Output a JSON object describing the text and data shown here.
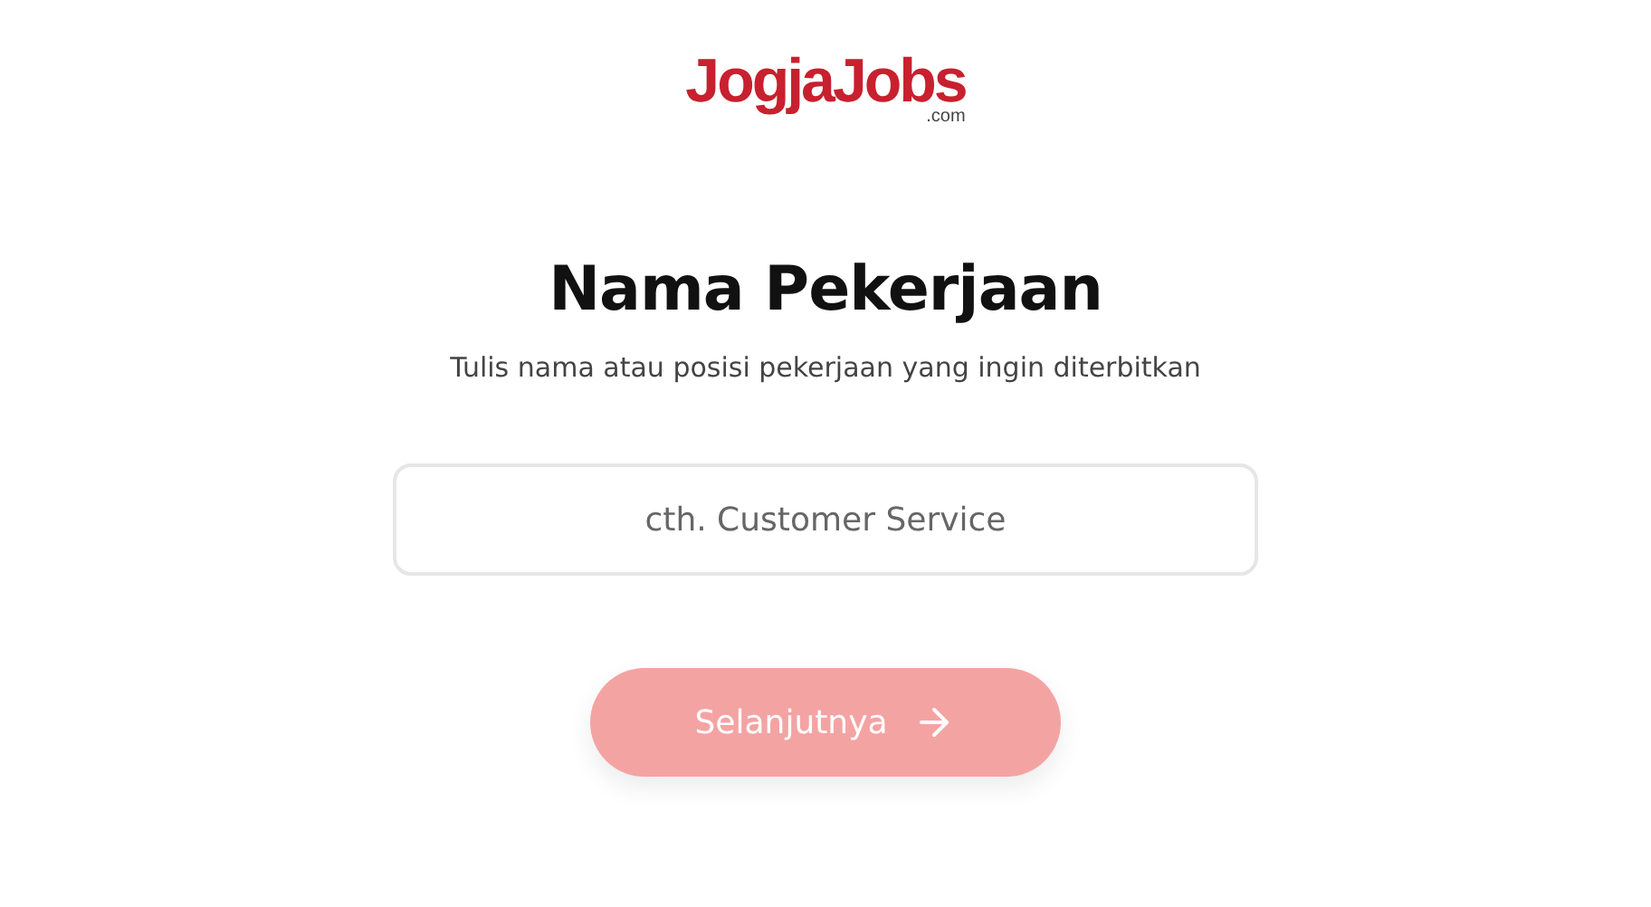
{
  "logo": {
    "name": "JogjaJobs",
    "suffix": ".com"
  },
  "heading": "Nama Pekerjaan",
  "subtitle": "Tulis nama atau posisi pekerjaan yang ingin diterbitkan",
  "job_field": {
    "placeholder": "cth. Customer Service"
  },
  "next_button": {
    "label": "Selanjutnya",
    "disabled": true
  }
}
